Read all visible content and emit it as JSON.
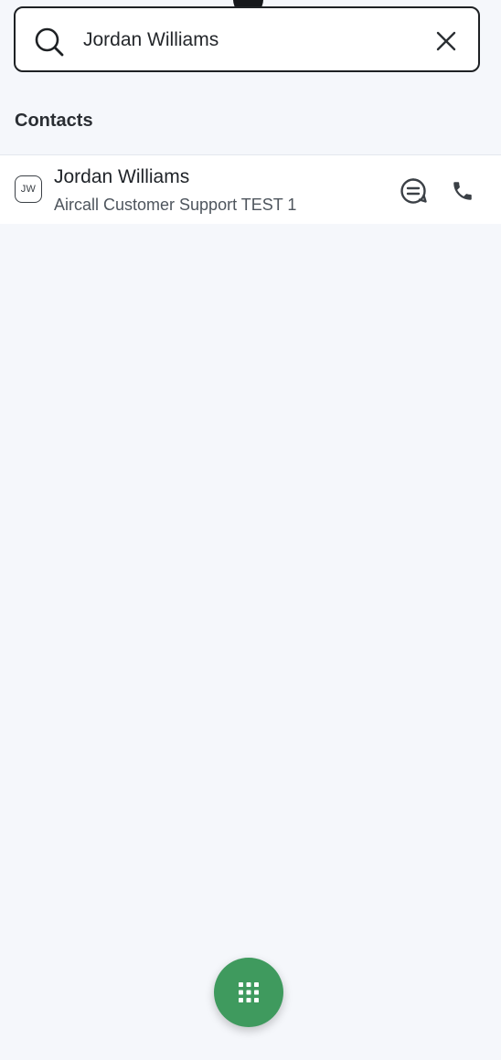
{
  "search": {
    "value": "Jordan Williams",
    "icon": "search-icon",
    "clear_icon": "close-icon"
  },
  "contacts_section": {
    "title": "Contacts",
    "items": [
      {
        "initials": "JW",
        "name": "Jordan Williams",
        "company": "Aircall Customer Support TEST 1",
        "actions": [
          "message-icon",
          "phone-icon"
        ]
      }
    ]
  },
  "fab": {
    "icon": "keypad-icon"
  },
  "colors": {
    "background": "#f5f7fb",
    "fab": "#3f9a5e",
    "text": "#1f2328",
    "secondary_text": "#4e555d"
  }
}
